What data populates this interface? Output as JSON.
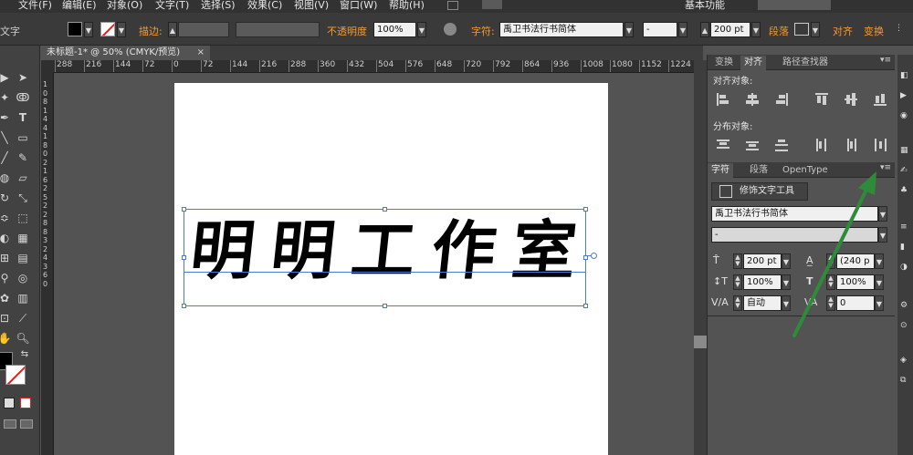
{
  "menu": [
    "文件(F)",
    "编辑(E)",
    "对象(O)",
    "文字(T)",
    "选择(S)",
    "效果(C)",
    "视图(V)",
    "窗口(W)",
    "帮助(H)"
  ],
  "workspace": "基本功能",
  "control": {
    "tool_name": "文字",
    "stroke_label": "描边:",
    "opacity_label": "不透明度",
    "opacity_value": "100%",
    "char_label": "字符:",
    "font_name": "禹卫书法行书简体",
    "font_style": "-",
    "font_size": "200 pt",
    "paragraph_label": "段落",
    "align_label": "对齐",
    "transform_label": "变换"
  },
  "doc_tab": {
    "title": "未标题-1* @ 50% (CMYK/预览)",
    "close": "×"
  },
  "ruler_h": [
    "288",
    "216",
    "144",
    "72",
    "0",
    "72",
    "144",
    "216",
    "288",
    "360",
    "432",
    "504",
    "576",
    "648",
    "720",
    "792",
    "864",
    "936",
    "1008",
    "1080",
    "1152",
    "1224"
  ],
  "ruler_v": [
    "1",
    "0",
    "8",
    "1",
    "4",
    "4",
    "1",
    "8",
    "0",
    "2",
    "1",
    "6",
    "2",
    "5",
    "2",
    "2",
    "8",
    "8",
    "3",
    "2",
    "4",
    "3",
    "6",
    "0"
  ],
  "artwork_text": "明明工作室",
  "align_panel": {
    "tabs": [
      "变换",
      "对齐",
      "路径查找器"
    ],
    "align_objects_label": "对齐对象:",
    "distribute_objects_label": "分布对象:"
  },
  "char_panel": {
    "tabs": [
      "字符",
      "段落",
      "OpenType"
    ],
    "touch_button": "修饰文字工具",
    "font_name": "禹卫书法行书简体",
    "font_style": "-",
    "font_size": "200 pt",
    "leading": "(240 p",
    "vscale": "100%",
    "hscale": "100%",
    "kerning": "自动",
    "tracking": "0"
  },
  "colors": {
    "accent_orange": "#f59a2e",
    "selection_blue": "#4a7bd0",
    "annotation_green": "#2e8b3a"
  }
}
